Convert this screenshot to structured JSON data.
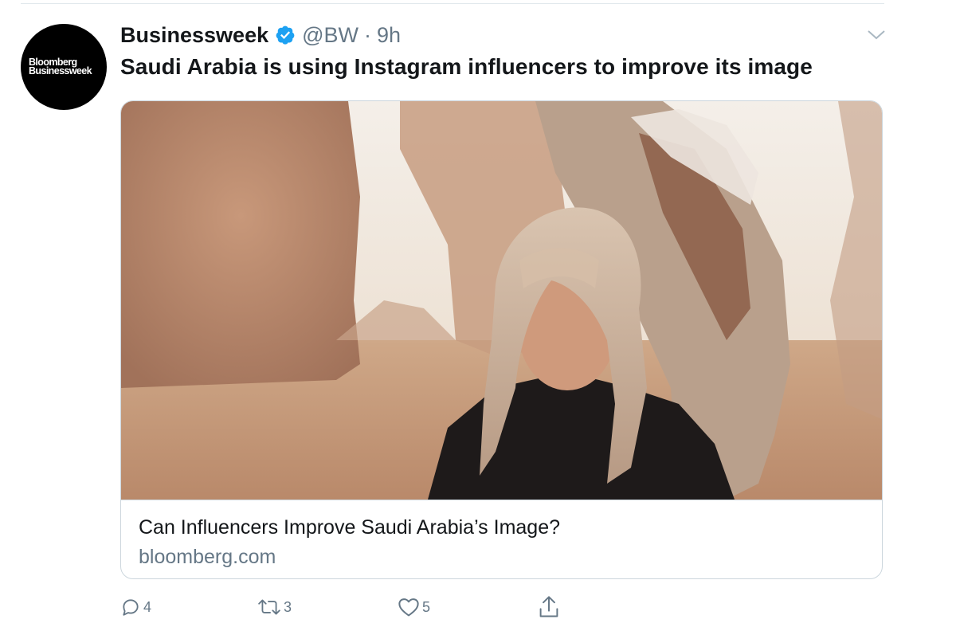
{
  "tweet": {
    "avatar_text_line1": "Bloomberg",
    "avatar_text_line2": "Businessweek",
    "display_name": "Businessweek",
    "handle": "@BW",
    "separator": "·",
    "time": "9h",
    "verified": true,
    "text": "Saudi Arabia is using Instagram influencers to improve its image"
  },
  "card": {
    "image_icon": "photo-woman-camel-desert",
    "title": "Can Influencers Improve Saudi Arabia’s Image?",
    "domain": "bloomberg.com"
  },
  "actions": {
    "reply_count": "4",
    "retweet_count": "3",
    "like_count": "5",
    "reply_icon": "reply-icon",
    "retweet_icon": "retweet-icon",
    "like_icon": "heart-icon",
    "share_icon": "share-icon"
  },
  "colors": {
    "text_primary": "#14171a",
    "text_secondary": "#657786",
    "verified_blue": "#1da1f2",
    "border": "#ccd6dd"
  }
}
